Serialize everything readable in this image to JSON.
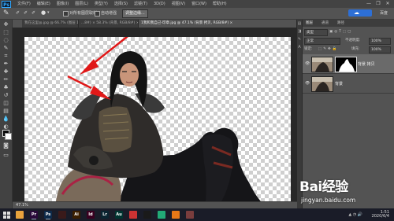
{
  "app": {
    "logo_text": "Ps"
  },
  "menubar": {
    "items": [
      "文件(F)",
      "编辑(E)",
      "图像(I)",
      "图层(L)",
      "类型(Y)",
      "选择(S)",
      "滤镜(T)",
      "3D(D)",
      "视图(V)",
      "窗口(W)",
      "帮助(H)"
    ],
    "window_buttons": [
      "—",
      "❐",
      "✕"
    ]
  },
  "optionsbar": {
    "sample_all_layers": "对所有图层取样",
    "auto_enhance": "自动增强",
    "refine_edge": "调整边缘...",
    "baidu_text": "百度"
  },
  "tabs": [
    {
      "label": "我在这里@.jpg @ 66.7% (图层 1, RGB/8#) ×",
      "active": false
    },
    {
      "label": "...8#) × 58.3% (背景, RGB/8#) ×",
      "active": false
    },
    {
      "label": "1我和我自己-印章.jpg @ 47.1% (背景 拷贝, RGB/8#) ×",
      "active": true
    }
  ],
  "status": {
    "zoom": "47.1%"
  },
  "layers_panel": {
    "tabs": [
      "图层",
      "通道",
      "路径"
    ],
    "kind_label": "类型",
    "blend_mode": "正常",
    "opacity_label": "不透明度:",
    "opacity_value": "100%",
    "lock_label": "锁定:",
    "fill_label": "填充:",
    "fill_value": "100%",
    "layers": [
      {
        "name": "背景 拷贝",
        "visible": true,
        "active": true,
        "has_mask": true
      },
      {
        "name": "背景",
        "visible": true,
        "active": false,
        "has_mask": false
      }
    ]
  },
  "watermark": {
    "logo": "Bai经验",
    "url": "jingyan.baidu.com"
  },
  "taskbar": {
    "apps": [
      {
        "icon": "folder-icon",
        "label": "",
        "color": "#e8a33d"
      },
      {
        "icon": "premiere-icon",
        "label": "Pr",
        "color": "#2a0a3a"
      },
      {
        "icon": "photoshop-icon",
        "label": "Ps",
        "color": "#0d2a4a"
      },
      {
        "icon": "media-icon",
        "label": "",
        "color": "#3a1a1a"
      },
      {
        "icon": "illustrator-icon",
        "label": "Ai",
        "color": "#3a1f00"
      },
      {
        "icon": "indesign-icon",
        "label": "Id",
        "color": "#3a0020"
      },
      {
        "icon": "lightroom-icon",
        "label": "Lr",
        "color": "#0a2430"
      },
      {
        "icon": "audition-icon",
        "label": "Au",
        "color": "#00332f"
      },
      {
        "icon": "browser-icon",
        "label": "",
        "color": "#c33"
      },
      {
        "icon": "qq-icon",
        "label": "",
        "color": "#1a1a1a"
      },
      {
        "icon": "chrome-icon",
        "label": "",
        "color": "#2a7"
      },
      {
        "icon": "firefox-icon",
        "label": "",
        "color": "#e67817"
      },
      {
        "icon": "game-icon",
        "label": "",
        "color": "#7a3d3d"
      }
    ],
    "clock_time": "1:51",
    "clock_date": "2020/6/4"
  }
}
